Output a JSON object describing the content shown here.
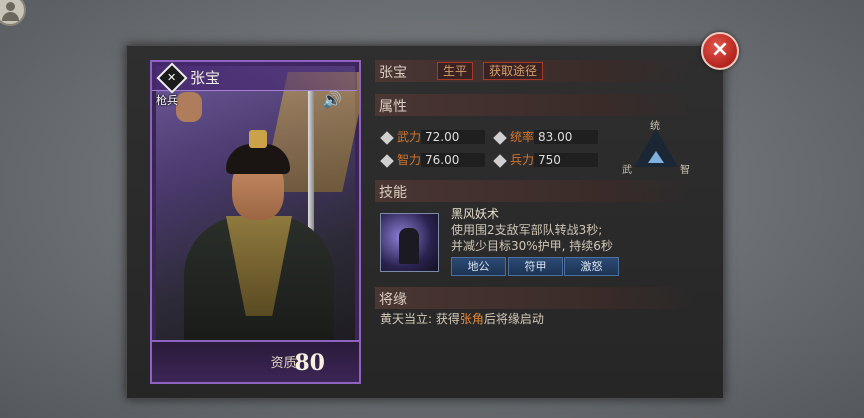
{
  "hero": {
    "name": "张宝",
    "type": "枪兵",
    "aptitude_label": "资质:",
    "aptitude_value": "80"
  },
  "header": {
    "name": "张宝",
    "tag_biography": "生平",
    "tag_obtain": "获取途径"
  },
  "attributes": {
    "title": "属性",
    "stats": [
      {
        "label": "武力",
        "value": "72.00"
      },
      {
        "label": "统率",
        "value": "83.00"
      },
      {
        "label": "智力",
        "value": "76.00"
      },
      {
        "label": "兵力",
        "value": "750"
      }
    ],
    "triangle": {
      "top": "统",
      "left": "武",
      "right": "智"
    }
  },
  "skill": {
    "title": "技能",
    "name": "黑风妖术",
    "desc_line1": "使用围2支敌军部队转战3秒;",
    "desc_line2": "并减少目标30%护甲, 持续6秒",
    "buttons": [
      "地公",
      "符甲",
      "激怒"
    ]
  },
  "bond": {
    "title": "将缘",
    "prefix": "黄天当立: 获得",
    "highlight": "张角",
    "suffix": "后将缘启动"
  },
  "close_label": "×"
}
